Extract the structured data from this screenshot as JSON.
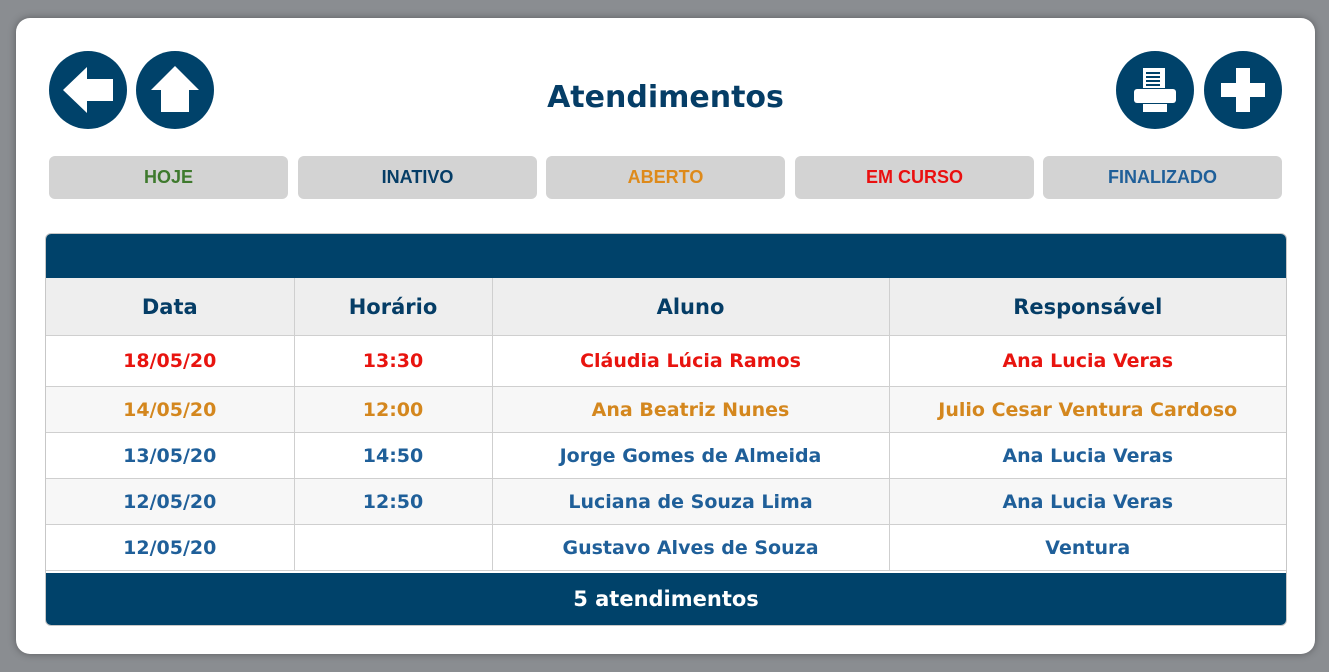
{
  "header": {
    "title": "Atendimentos",
    "buttons": {
      "back": "arrow-left-icon",
      "home": "home-icon",
      "print": "printer-icon",
      "add": "plus-icon"
    }
  },
  "filters": [
    {
      "label": "HOJE",
      "color": "#3f7a2e"
    },
    {
      "label": "INATIVO",
      "color": "#053d66"
    },
    {
      "label": "ABERTO",
      "color": "#de8a1a"
    },
    {
      "label": "EM CURSO",
      "color": "#ea1010"
    },
    {
      "label": "FINALIZADO",
      "color": "#1f5f99"
    }
  ],
  "table": {
    "columns": [
      "Data",
      "Horário",
      "Aluno",
      "Responsável"
    ],
    "rows": [
      {
        "data": "18/05/20",
        "horario": "13:30",
        "aluno": "Cláudia Lúcia Ramos",
        "responsavel": "Ana Lucia Veras",
        "status_color": "#e8140f"
      },
      {
        "data": "14/05/20",
        "horario": "12:00",
        "aluno": "Ana Beatriz Nunes",
        "responsavel": "Julio Cesar Ventura Cardoso",
        "status_color": "#d4871e"
      },
      {
        "data": "13/05/20",
        "horario": "14:50",
        "aluno": "Jorge Gomes de Almeida",
        "responsavel": "Ana Lucia Veras",
        "status_color": "#1f5f99"
      },
      {
        "data": "12/05/20",
        "horario": "12:50",
        "aluno": "Luciana de Souza Lima",
        "responsavel": "Ana Lucia Veras",
        "status_color": "#1f5f99"
      },
      {
        "data": "12/05/20",
        "horario": "",
        "aluno": "Gustavo Alves de Souza",
        "responsavel": "Ventura",
        "status_color": "#1f5f99"
      }
    ],
    "footer": "5 atendimentos"
  },
  "colors": {
    "primary": "#00426a",
    "filter_bg": "#d3d3d3",
    "header_row_bg": "#eeeeee"
  }
}
